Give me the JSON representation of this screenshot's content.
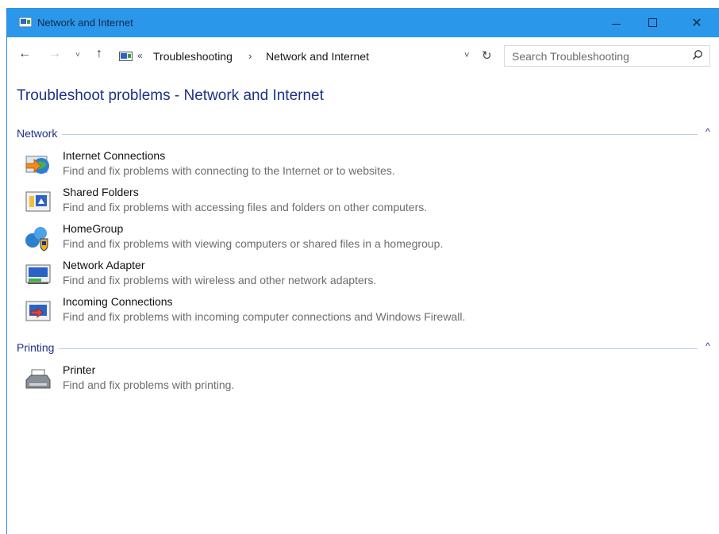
{
  "window": {
    "title": "Network and Internet",
    "controls": {
      "minimize": "minimize",
      "maximize": "maximize",
      "close": "✕"
    }
  },
  "nav": {
    "back": "←",
    "forward": "→",
    "recent": "˅",
    "up": "↑",
    "address": {
      "overflow": "«",
      "breadcrumbs": [
        "Troubleshooting",
        "Network and Internet"
      ],
      "separator": "›",
      "dropdown": "˅",
      "refresh": "↻"
    },
    "search": {
      "placeholder": "Search Troubleshooting"
    }
  },
  "page": {
    "title": "Troubleshoot problems - Network and Internet"
  },
  "groups": [
    {
      "label": "Network",
      "items": [
        {
          "title": "Internet Connections",
          "desc": "Find and fix problems with connecting to the Internet or to websites.",
          "icon": "internet-connections-icon"
        },
        {
          "title": "Shared Folders",
          "desc": "Find and fix problems with accessing files and folders on other computers.",
          "icon": "shared-folders-icon"
        },
        {
          "title": "HomeGroup",
          "desc": "Find and fix problems with viewing computers or shared files in a homegroup.",
          "icon": "homegroup-icon"
        },
        {
          "title": "Network Adapter",
          "desc": "Find and fix problems with wireless and other network adapters.",
          "icon": "network-adapter-icon"
        },
        {
          "title": "Incoming Connections",
          "desc": "Find and fix problems with incoming computer connections and Windows Firewall.",
          "icon": "incoming-connections-icon"
        }
      ]
    },
    {
      "label": "Printing",
      "items": [
        {
          "title": "Printer",
          "desc": "Find and fix problems with printing.",
          "icon": "printer-icon"
        }
      ]
    }
  ],
  "colors": {
    "titlebar": "#2b97ea",
    "heading": "#1e3287",
    "description": "#6d6d6d"
  }
}
